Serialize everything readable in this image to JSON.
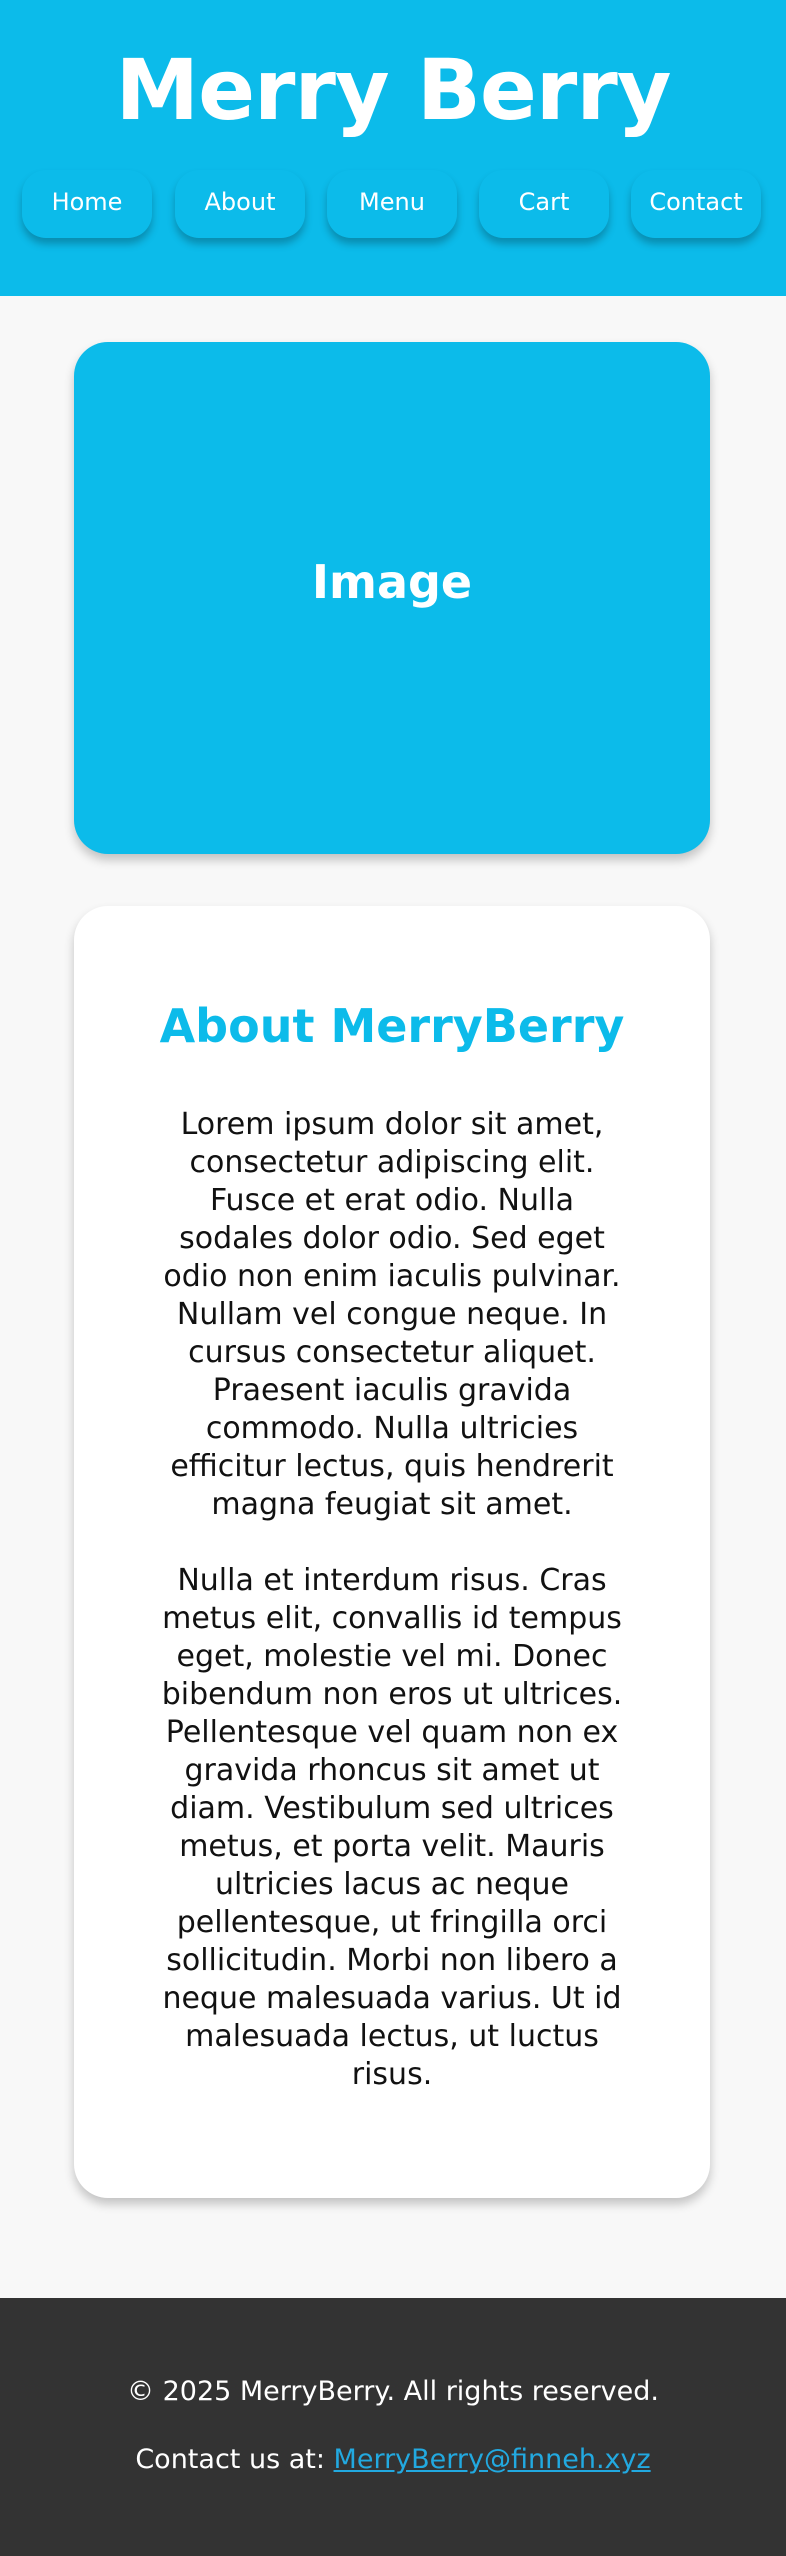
{
  "header": {
    "title": "Merry Berry",
    "nav": [
      "Home",
      "About",
      "Menu",
      "Cart",
      "Contact"
    ]
  },
  "hero": {
    "label": "Image"
  },
  "about": {
    "title": "About MerryBerry",
    "paragraphs": [
      "Lorem ipsum dolor sit amet, consectetur adipiscing elit. Fusce et erat odio. Nulla sodales dolor odio. Sed eget odio non enim iaculis pulvinar. Nullam vel congue neque. In cursus consectetur aliquet. Praesent iaculis gravida commodo. Nulla ultricies efficitur lectus, quis hendrerit magna feugiat sit amet.",
      "Nulla et interdum risus. Cras metus elit, convallis id tempus eget, molestie vel mi. Donec bibendum non eros ut ultrices. Pellentesque vel quam non ex gravida rhoncus sit amet ut diam. Vestibulum sed ultrices metus, et porta velit. Mauris ultricies lacus ac neque pellentesque, ut fringilla orci sollicitudin. Morbi non libero a neque malesuada varius. Ut id malesuada lectus, ut luctus risus."
    ]
  },
  "footer": {
    "copyright": "© 2025 MerryBerry. All rights reserved.",
    "contact_prefix": "Contact us at: ",
    "contact_email": "MerryBerry@finneh.xyz"
  },
  "colors": {
    "brand": "#0cbbea",
    "footer_bg": "#333333",
    "link": "#22a9e0"
  }
}
